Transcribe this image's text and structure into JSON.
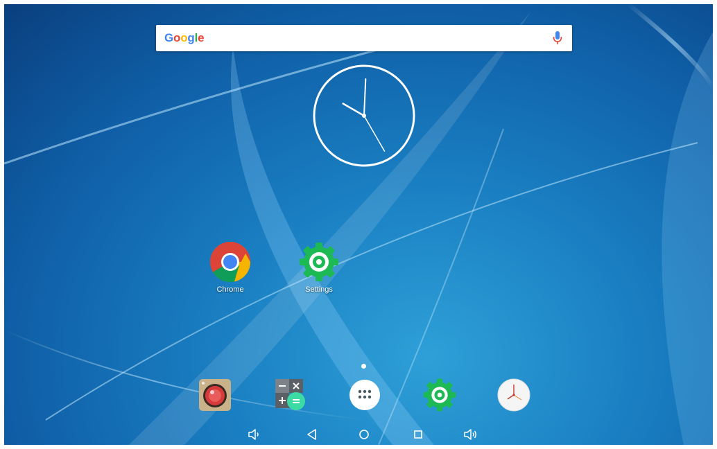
{
  "search": {
    "logo_letters": [
      {
        "char": "G",
        "color": "#4285F4"
      },
      {
        "char": "o",
        "color": "#EA4335"
      },
      {
        "char": "o",
        "color": "#FBBC05"
      },
      {
        "char": "g",
        "color": "#4285F4"
      },
      {
        "char": "l",
        "color": "#34A853"
      },
      {
        "char": "e",
        "color": "#EA4335"
      }
    ],
    "mic_icon": "microphone-icon"
  },
  "clock": {
    "hour": 10,
    "minute": 0,
    "second": 25
  },
  "desktop_apps": [
    {
      "label": "Chrome",
      "icon": "chrome-icon"
    },
    {
      "label": "Settings",
      "icon": "settings-gear-icon"
    }
  ],
  "dock": [
    {
      "icon": "camera-icon"
    },
    {
      "icon": "calculator-icon"
    },
    {
      "icon": "all-apps-icon"
    },
    {
      "icon": "settings-gear-icon"
    },
    {
      "icon": "clock-icon"
    }
  ],
  "nav_bar": [
    {
      "icon": "volume-down-icon"
    },
    {
      "icon": "back-icon"
    },
    {
      "icon": "home-icon"
    },
    {
      "icon": "recents-icon"
    },
    {
      "icon": "volume-up-icon"
    }
  ],
  "colors": {
    "settings_green": "#1DB954",
    "accent_mint": "#3DDBA4"
  }
}
